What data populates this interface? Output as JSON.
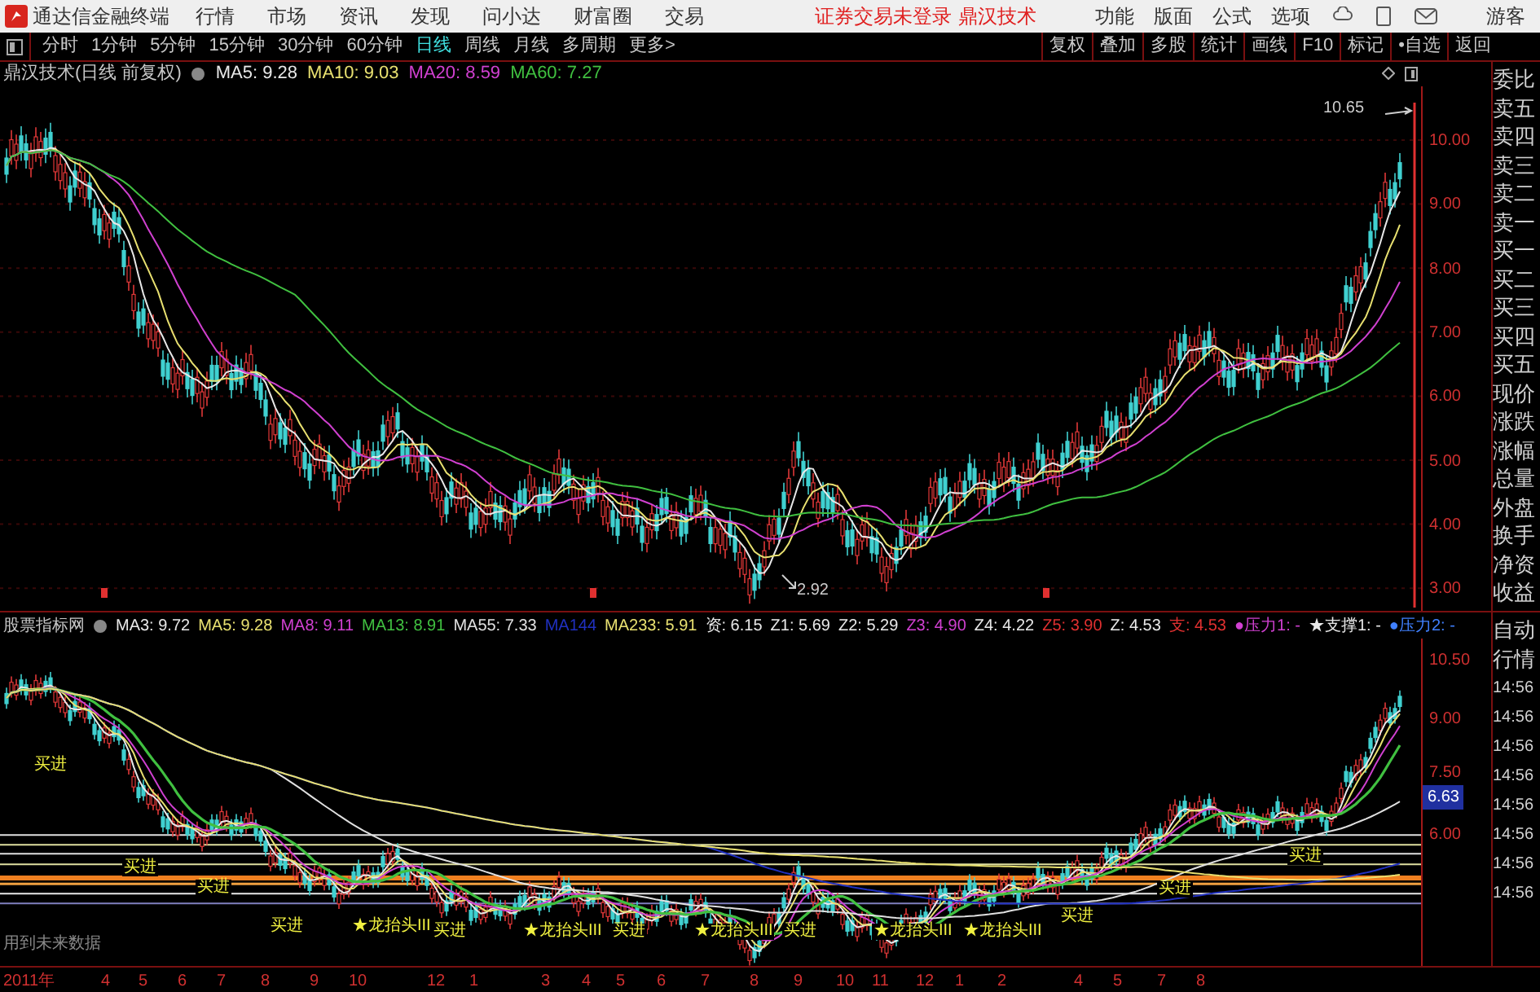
{
  "menu_bar": {
    "app_title": "通达信金融终端",
    "menus": [
      "行情",
      "市场",
      "资讯",
      "发现",
      "问小达",
      "财富圈",
      "交易"
    ],
    "login_status": "证券交易未登录",
    "stock_name": "鼎汉技术",
    "tools": [
      "功能",
      "版面",
      "公式",
      "选项"
    ],
    "user": "游客"
  },
  "period_tabs": [
    {
      "label": "分时",
      "selected": false
    },
    {
      "label": "1分钟",
      "selected": false
    },
    {
      "label": "5分钟",
      "selected": false
    },
    {
      "label": "15分钟",
      "selected": false
    },
    {
      "label": "30分钟",
      "selected": false
    },
    {
      "label": "60分钟",
      "selected": false
    },
    {
      "label": "日线",
      "selected": true
    },
    {
      "label": "周线",
      "selected": false
    },
    {
      "label": "月线",
      "selected": false
    },
    {
      "label": "多周期",
      "selected": false
    },
    {
      "label": "更多>",
      "selected": false
    }
  ],
  "actions": [
    "复权",
    "叠加",
    "多股",
    "统计",
    "画线",
    "F10",
    "标记",
    "•自选",
    "返回"
  ],
  "main_chart": {
    "title": "鼎汉技术(日线 前复权)",
    "indicators": [
      {
        "label": "MA5: 9.28",
        "color": "#e8e8e8"
      },
      {
        "label": "MA10: 9.03",
        "color": "#e8e070"
      },
      {
        "label": "MA20: 8.59",
        "color": "#d040d0"
      },
      {
        "label": "MA60: 7.27",
        "color": "#40c040"
      }
    ],
    "price_labels": [
      "10.00",
      "9.00",
      "8.00",
      "7.00",
      "6.00",
      "5.00",
      "4.00",
      "3.00"
    ],
    "high_label": "10.65",
    "low_label": "2.92"
  },
  "quote_panel": [
    "委比",
    "卖五",
    "卖四",
    "卖三",
    "卖二",
    "卖一",
    "买一",
    "买二",
    "买三",
    "买四",
    "买五",
    "现价",
    "涨跌",
    "涨幅",
    "总量",
    "外盘",
    "换手",
    "净资",
    "收益"
  ],
  "indicator_chart": {
    "title": "股票指标网",
    "indicators": [
      {
        "label": "MA3: 9.72",
        "color": "#e8e8e8"
      },
      {
        "label": "MA5: 9.28",
        "color": "#e8e070"
      },
      {
        "label": "MA8: 9.11",
        "color": "#d040d0"
      },
      {
        "label": "MA13: 8.91",
        "color": "#40c040"
      },
      {
        "label": "MA55: 7.33",
        "color": "#e0e0e0"
      },
      {
        "label": "MA144",
        "color": "#2030c0"
      },
      {
        "label": "MA233: 5.91",
        "color": "#e8e070"
      },
      {
        "label": "资: 6.15",
        "color": "#e8e8e8"
      },
      {
        "label": "Z1: 5.69",
        "color": "#e8e8e8"
      },
      {
        "label": "Z2: 5.29",
        "color": "#e8e8e8"
      },
      {
        "label": "Z3: 4.90",
        "color": "#d040d0"
      },
      {
        "label": "Z4: 4.22",
        "color": "#e8e8e8"
      },
      {
        "label": "Z5: 3.90",
        "color": "#e03030"
      },
      {
        "label": "Z: 4.53",
        "color": "#e8e8e8"
      },
      {
        "label": "支: 4.53",
        "color": "#e03030"
      },
      {
        "label": "●压力1: -",
        "color": "#d040d0"
      },
      {
        "label": "★支撑1: -",
        "color": "#e8e8e8"
      },
      {
        "label": "●压力2: -",
        "color": "#4080ff"
      }
    ],
    "price_labels": [
      {
        "text": "10.50",
        "kind": "plain"
      },
      {
        "text": "9.00",
        "kind": "plain"
      },
      {
        "text": "7.50",
        "kind": "plain"
      },
      {
        "text": "6.63",
        "kind": "current"
      },
      {
        "text": "6.00",
        "kind": "plain"
      }
    ],
    "signals": [
      "买进",
      "买进",
      "买进",
      "买进",
      "★龙抬头III",
      "买进",
      "★龙抬头III",
      "买进",
      "★龙抬头III",
      "买进",
      "★龙抬头III",
      "★龙抬头III",
      "买进",
      "买进",
      "买进"
    ],
    "note": "用到未来数据"
  },
  "time_panel": [
    "自动",
    "行情",
    "14:56",
    "14:56",
    "14:56",
    "14:56",
    "14:56",
    "14:56",
    "14:56",
    "14:56"
  ],
  "x_axis": [
    "2011年",
    "4",
    "5",
    "6",
    "7",
    "8",
    "9",
    "10",
    "12",
    "1",
    "3",
    "4",
    "5",
    "6",
    "7",
    "8",
    "9",
    "10",
    "11",
    "12",
    "1",
    "2",
    "4",
    "5",
    "7",
    "8"
  ]
}
